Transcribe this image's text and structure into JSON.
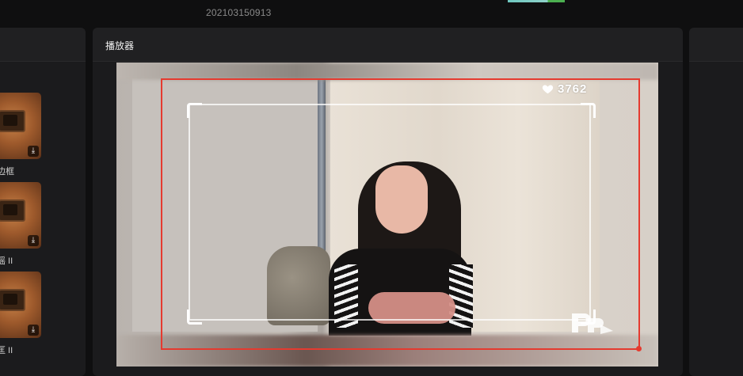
{
  "header": {
    "project_id": "202103150913"
  },
  "player": {
    "title": "播放器"
  },
  "assets": [
    {
      "label": "边框"
    },
    {
      "label": "摇 II"
    },
    {
      "label": "匡 II"
    }
  ],
  "overlay": {
    "like_count": "3762"
  },
  "colors": {
    "selection": "#e53a2f",
    "panel": "#1b1b1d",
    "background": "#0f0f10"
  }
}
